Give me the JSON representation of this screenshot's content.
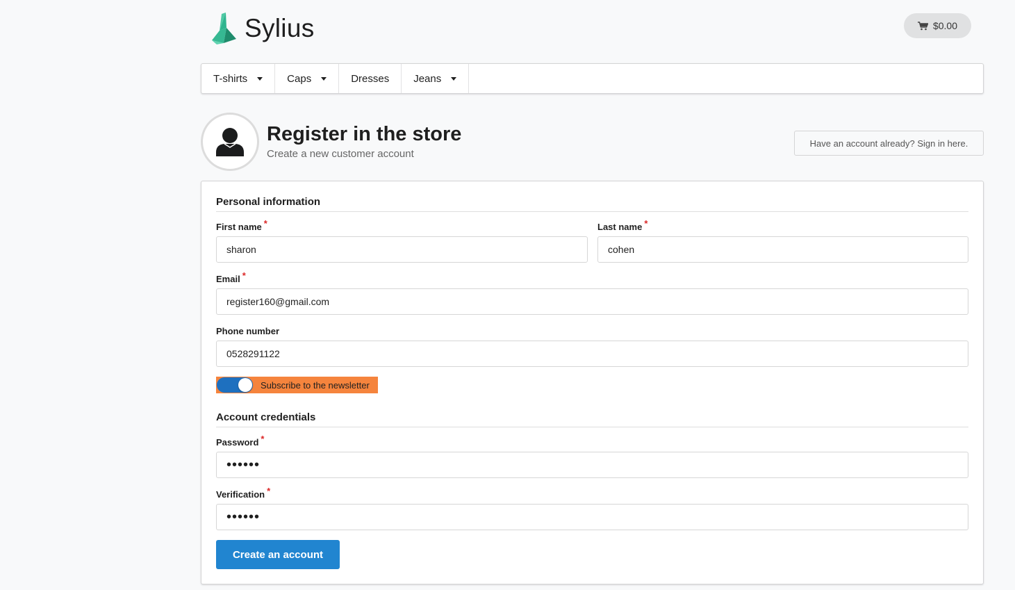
{
  "brand": {
    "name": "Sylius",
    "logo_icon": "swan-logo-icon"
  },
  "cart": {
    "total": "$0.00",
    "icon": "cart-icon"
  },
  "menu": {
    "items": [
      {
        "label": "T-shirts",
        "has_dropdown": true
      },
      {
        "label": "Caps",
        "has_dropdown": true
      },
      {
        "label": "Dresses",
        "has_dropdown": false
      },
      {
        "label": "Jeans",
        "has_dropdown": true
      }
    ]
  },
  "header": {
    "title": "Register in the store",
    "subtitle": "Create a new customer account",
    "icon": "user-icon",
    "signin_label": "Have an account already? Sign in here."
  },
  "form": {
    "personal_title": "Personal information",
    "first_name": {
      "label": "First name",
      "value": "sharon",
      "required": "*"
    },
    "last_name": {
      "label": "Last name",
      "value": "cohen",
      "required": "*"
    },
    "email": {
      "label": "Email",
      "value": "register160@gmail.com",
      "required": "*"
    },
    "phone": {
      "label": "Phone number",
      "value": "0528291122"
    },
    "newsletter": {
      "label": "Subscribe to the newsletter",
      "checked": true
    },
    "credentials_title": "Account credentials",
    "password": {
      "label": "Password",
      "value": "••••••",
      "required": "*"
    },
    "verification": {
      "label": "Verification",
      "value": "••••••",
      "required": "*"
    },
    "submit_label": "Create an account"
  },
  "colors": {
    "primary": "#2185d0",
    "logo_teal": "#2fb58f",
    "required": "#db2828",
    "highlight": "#f5843d",
    "toggle_on": "#1e70bf"
  }
}
